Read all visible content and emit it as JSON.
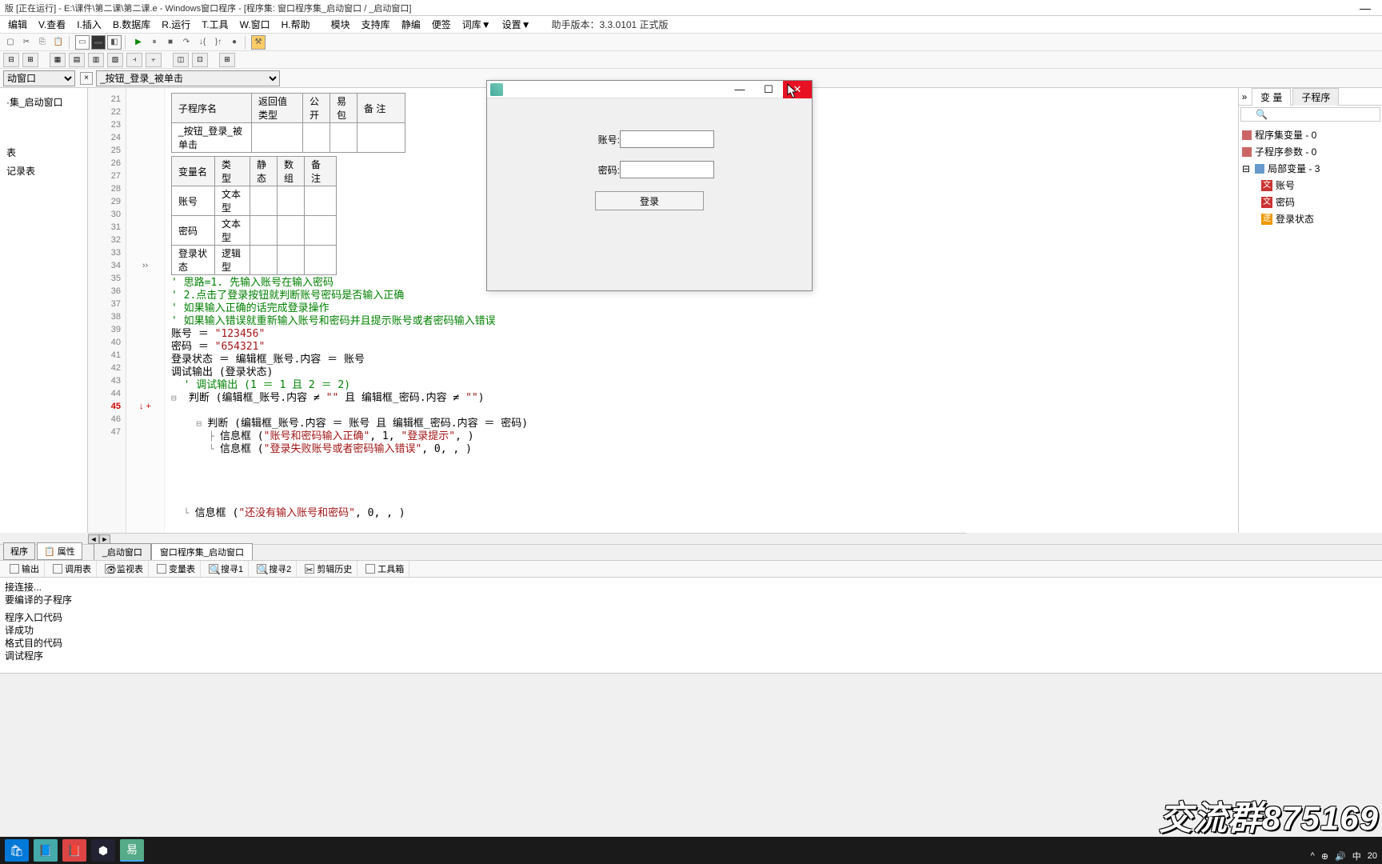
{
  "window": {
    "title": "版 [正在运行] - E:\\课件\\第二课\\第二课.e - Windows窗口程序 - [程序集: 窗口程序集_启动窗口 / _启动窗口]"
  },
  "menu": {
    "items": [
      "编辑",
      "V.查看",
      "I.插入",
      "B.数据库",
      "R.运行",
      "T.工具",
      "W.窗口",
      "H.帮助",
      "模块",
      "支持库",
      "静编",
      "便签",
      "词库▼",
      "设置▼"
    ],
    "version": "助手版本：3.3.0101 正式版"
  },
  "combo": {
    "c1": "动窗口",
    "c2": "_按钮_登录_被单击"
  },
  "left_tree": {
    "items": [
      "·集_启动窗口",
      "表",
      "记录表"
    ]
  },
  "gutter": {
    "start": 21,
    "end": 47,
    "hl": 45
  },
  "header_tables": {
    "sub": {
      "cols": [
        "子程序名",
        "返回值类型",
        "公开",
        "易包",
        "备 注"
      ],
      "row": [
        "_按钮_登录_被单击",
        "",
        "",
        "",
        ""
      ]
    },
    "vars": {
      "cols": [
        "变量名",
        "类 型",
        "静态",
        "数组",
        "备 注"
      ],
      "rows": [
        [
          "账号",
          "文本型",
          "",
          "",
          ""
        ],
        [
          "密码",
          "文本型",
          "",
          "",
          ""
        ],
        [
          "登录状态",
          "逻辑型",
          "",
          "",
          ""
        ]
      ]
    }
  },
  "code": {
    "l27": "' 思路=1. 先输入账号在输入密码",
    "l28": "' 2.点击了登录按钮就判断账号密码是否输入正确",
    "l29": "' 如果输入正确的话完成登录操作",
    "l30": "' 如果输入错误就重新输入账号和密码并且提示账号或者密码输入错误",
    "l31_a": "账号 ＝ ",
    "l31_s": "\"123456\"",
    "l32_a": "密码 ＝ ",
    "l32_s": "\"654321\"",
    "l33": "登录状态 ＝ 编辑框_账号.内容 ＝ 账号",
    "l34_mark": "››",
    "l34": "调试输出 (登录状态)",
    "l35": "' 调试输出 (1 ＝ 1 且 2 ＝ 2)",
    "l36_a": "判断 (编辑框_账号.内容 ≠ ",
    "l36_s1": "\"\"",
    "l36_b": " 且 编辑框_密码.内容 ≠ ",
    "l36_s2": "\"\"",
    "l36_c": ")",
    "l38_a": "判断 (编辑框_账号.内容 ＝ 账号 且 编辑框_密码.内容 ＝ 密码)",
    "l39_a": "信息框 (",
    "l39_s1": "\"账号和密码输入正确\"",
    "l39_b": ", 1, ",
    "l39_s2": "\"登录提示\"",
    "l39_c": ", )",
    "l40_a": "信息框 (",
    "l40_s1": "\"登录失败账号或者密码输入错误\"",
    "l40_b": ", 0, , )",
    "l45_mark": "↓ +",
    "l45_a": "信息框 (",
    "l45_s1": "\"还没有输入账号和密码\"",
    "l45_b": ", 0, , )"
  },
  "runtime": {
    "label_account": "账号:",
    "label_password": "密码:",
    "btn": "登录"
  },
  "right": {
    "tabs": [
      "变 量",
      "子程序"
    ],
    "items": [
      {
        "label": "程序集变量 - 0",
        "icon": "#c66"
      },
      {
        "label": "子程序参数 - 0",
        "icon": "#c66"
      },
      {
        "label": "局部变量 - 3",
        "icon": "#69c",
        "exp": true
      },
      {
        "label": "账号",
        "icon": "文",
        "indent": true,
        "ic": "#c33"
      },
      {
        "label": "密码",
        "icon": "文",
        "indent": true,
        "ic": "#c33"
      },
      {
        "label": "登录状态",
        "icon": "逻",
        "indent": true,
        "ic": "#e90"
      }
    ],
    "search_ph": "🔍"
  },
  "bottom_tabs": {
    "left": [
      "程序",
      "属性"
    ],
    "code_tabs": [
      "_启动窗口",
      "窗口程序集_启动窗口"
    ]
  },
  "bottombar": {
    "items": [
      "输出",
      "调用表",
      "监视表",
      "变量表",
      "搜寻1",
      "搜寻2",
      "剪辑历史",
      "工具箱"
    ]
  },
  "output": {
    "lines": [
      "接连接...",
      "要编译的子程序",
      "程序入口代码",
      "译成功",
      "格式目的代码",
      "调试程序"
    ]
  },
  "watermark": "交流群875169",
  "taskbar": {
    "time": "20"
  }
}
